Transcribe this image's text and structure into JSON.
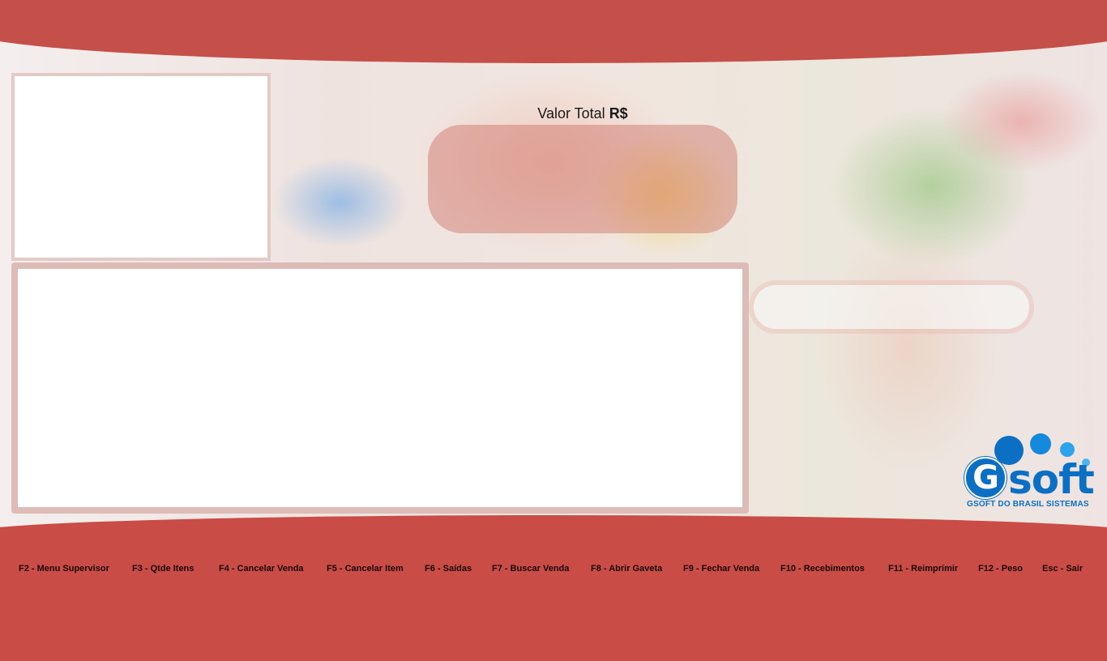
{
  "total": {
    "label": "Valor Total",
    "currency": "R$",
    "value": ""
  },
  "logo": {
    "letter": "G",
    "word": "soft",
    "subtitle": "GSOFT DO BRASIL SISTEMAS",
    "color": "#0b6fc4"
  },
  "function_keys": [
    "F2 - Menu Supervisor",
    "F3 - Qtde Itens",
    "F4 - Cancelar Venda",
    "F5 - Cancelar Item",
    "F6 - Saídas",
    "F7 - Buscar Venda",
    "F8 - Abrir Gaveta",
    "F9 - Fechar Venda",
    "F10 - Recebimentos",
    "F11 - Reimprimir",
    "F12 - Peso",
    "Esc - Sair"
  ],
  "colors": {
    "band": "#c94c47",
    "panel_border": "#e3cac6",
    "total_box": "#cd6e64"
  }
}
